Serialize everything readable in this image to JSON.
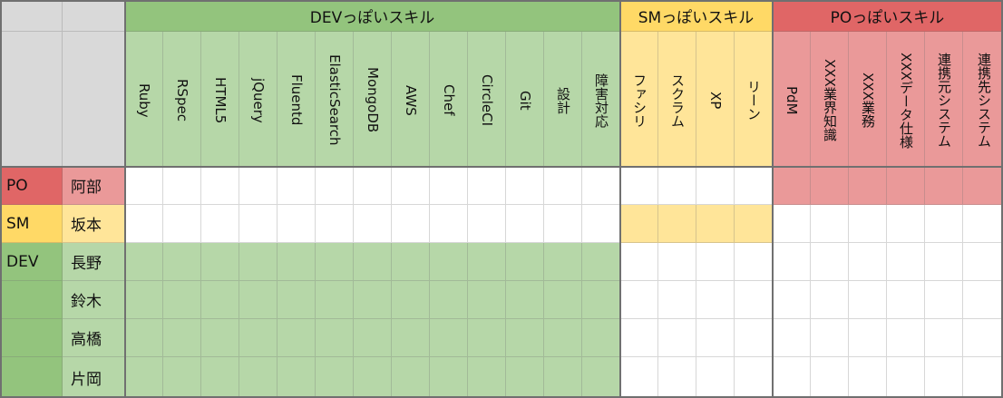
{
  "colors": {
    "dev_header": "#93c47d",
    "dev_light": "#b6d7a8",
    "sm_header": "#ffd966",
    "sm_light": "#ffe599",
    "po_header": "#e06666",
    "po_light": "#ea9999",
    "gray": "#d9d9d9",
    "frame": "#707070"
  },
  "groups": [
    {
      "key": "dev",
      "label": "DEVっぽいスキル",
      "skills": [
        "Ruby",
        "RSpec",
        "HTML5",
        "jQuery",
        "Fluentd",
        "ElasticSearch",
        "MongoDB",
        "AWS",
        "Chef",
        "CircleCI",
        "Git",
        "設計",
        "障害対応"
      ]
    },
    {
      "key": "sm",
      "label": "SMっぽいスキル",
      "skills": [
        "ファシリ",
        "スクラム",
        "XP",
        "リーン"
      ]
    },
    {
      "key": "po",
      "label": "POっぽいスキル",
      "skills": [
        "PdM",
        "XXX業界知識",
        "XXX業務",
        "XXXデータ仕様",
        "連携元システム",
        "連携先システム"
      ]
    }
  ],
  "members": [
    {
      "role": "PO",
      "role_key": "po",
      "name": "阿部"
    },
    {
      "role": "SM",
      "role_key": "sm",
      "name": "坂本"
    },
    {
      "role": "DEV",
      "role_key": "dev",
      "name": "長野"
    },
    {
      "role": "",
      "role_key": "dev",
      "name": "鈴木"
    },
    {
      "role": "",
      "role_key": "dev",
      "name": "高橋"
    },
    {
      "role": "",
      "role_key": "dev",
      "name": "片岡"
    }
  ]
}
